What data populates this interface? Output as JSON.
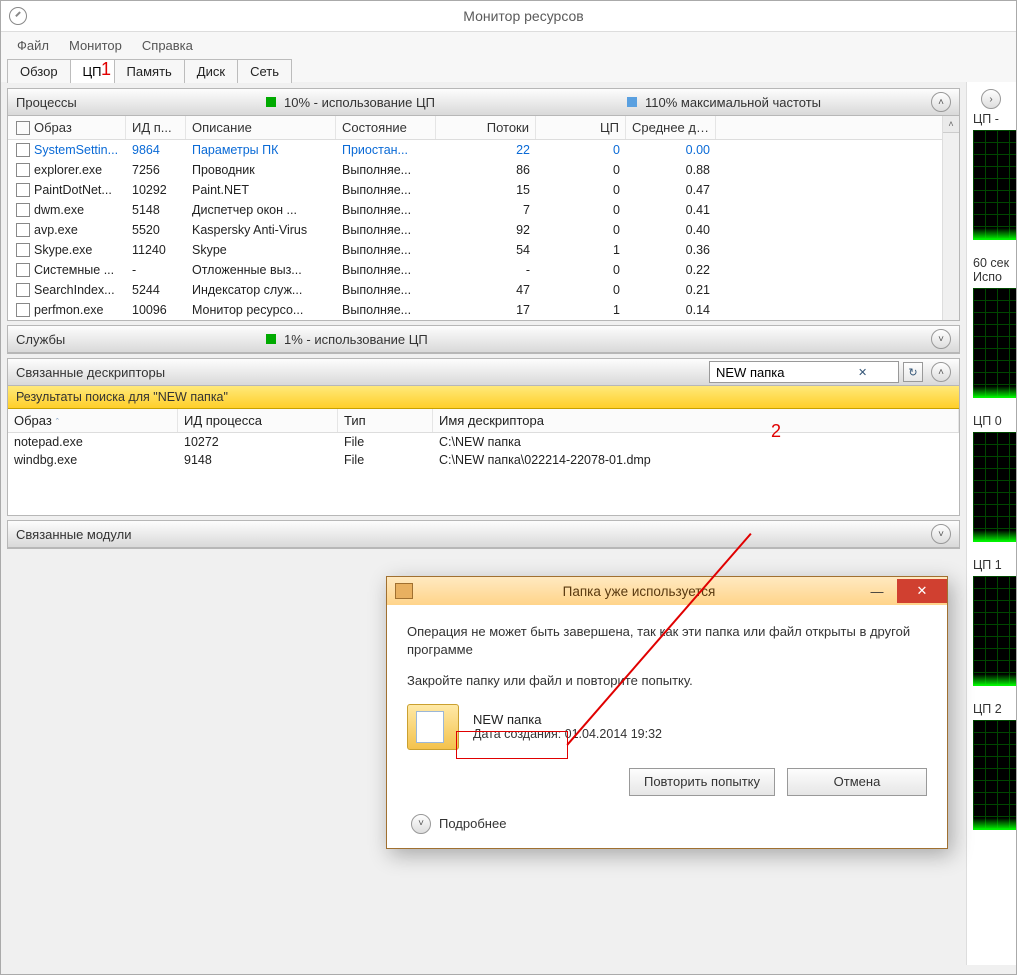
{
  "window": {
    "title": "Монитор ресурсов"
  },
  "menu": {
    "file": "Файл",
    "monitor": "Монитор",
    "help": "Справка"
  },
  "tabs": {
    "overview": "Обзор",
    "cpu": "ЦП",
    "memory": "Память",
    "disk": "Диск",
    "network": "Сеть"
  },
  "processes_panel": {
    "title": "Процессы",
    "stat_cpu": "10% - использование ЦП",
    "stat_freq": "110% максимальной частоты",
    "columns": {
      "image": "Образ",
      "pid": "ИД п...",
      "desc": "Описание",
      "state": "Состояние",
      "threads": "Потоки",
      "cpu": "ЦП",
      "avg": "Среднее д..."
    },
    "rows": [
      {
        "image": "SystemSettin...",
        "pid": "9864",
        "desc": "Параметры ПК",
        "state": "Приостан...",
        "threads": "22",
        "cpu": "0",
        "avg": "0.00",
        "selected": true
      },
      {
        "image": "explorer.exe",
        "pid": "7256",
        "desc": "Проводник",
        "state": "Выполняе...",
        "threads": "86",
        "cpu": "0",
        "avg": "0.88"
      },
      {
        "image": "PaintDotNet...",
        "pid": "10292",
        "desc": "Paint.NET",
        "state": "Выполняе...",
        "threads": "15",
        "cpu": "0",
        "avg": "0.47"
      },
      {
        "image": "dwm.exe",
        "pid": "5148",
        "desc": "Диспетчер окон ...",
        "state": "Выполняе...",
        "threads": "7",
        "cpu": "0",
        "avg": "0.41"
      },
      {
        "image": "avp.exe",
        "pid": "5520",
        "desc": "Kaspersky Anti-Virus",
        "state": "Выполняе...",
        "threads": "92",
        "cpu": "0",
        "avg": "0.40"
      },
      {
        "image": "Skype.exe",
        "pid": "11240",
        "desc": "Skype",
        "state": "Выполняе...",
        "threads": "54",
        "cpu": "1",
        "avg": "0.36"
      },
      {
        "image": "Системные ...",
        "pid": "-",
        "desc": "Отложенные выз...",
        "state": "Выполняе...",
        "threads": "-",
        "cpu": "0",
        "avg": "0.22"
      },
      {
        "image": "SearchIndex...",
        "pid": "5244",
        "desc": "Индексатор служ...",
        "state": "Выполняе...",
        "threads": "47",
        "cpu": "0",
        "avg": "0.21"
      },
      {
        "image": "perfmon.exe",
        "pid": "10096",
        "desc": "Монитор ресурсо...",
        "state": "Выполняе...",
        "threads": "17",
        "cpu": "1",
        "avg": "0.14"
      }
    ]
  },
  "services_panel": {
    "title": "Службы",
    "stat_cpu": "1% - использование ЦП"
  },
  "handles_panel": {
    "title": "Связанные дескрипторы",
    "search_value": "NEW папка",
    "results_label": "Результаты поиска для \"NEW папка\"",
    "columns": {
      "image": "Образ",
      "pid": "ИД процесса",
      "type": "Тип",
      "name": "Имя дескриптора"
    },
    "rows": [
      {
        "image": "notepad.exe",
        "pid": "10272",
        "type": "File",
        "name": "C:\\NEW папка"
      },
      {
        "image": "windbg.exe",
        "pid": "9148",
        "type": "File",
        "name": "C:\\NEW папка\\022214-22078-01.dmp"
      }
    ]
  },
  "modules_panel": {
    "title": "Связанные модули"
  },
  "side": {
    "cpu_total": "ЦП -",
    "sixty_sec": "60 сек",
    "usage_label": "Испо",
    "cpu0": "ЦП 0",
    "cpu1": "ЦП 1",
    "cpu2": "ЦП 2"
  },
  "dialog": {
    "title": "Папка уже используется",
    "line1": "Операция не может быть завершена, так как эти папка или файл открыты в другой программе",
    "line2": "Закройте папку или файл и повторите попытку.",
    "folder_name": "NEW папка",
    "created": "Дата создания: 01.04.2014 19:32",
    "retry": "Повторить попытку",
    "cancel": "Отмена",
    "more": "Подробнее",
    "minimize": "—",
    "close": "✕"
  },
  "annotations": {
    "one": "1",
    "two": "2"
  },
  "glyphs": {
    "clear": "✕",
    "refresh": "↻",
    "up": "˄",
    "down": "˅",
    "right": "›",
    "sort": "ˆ"
  }
}
